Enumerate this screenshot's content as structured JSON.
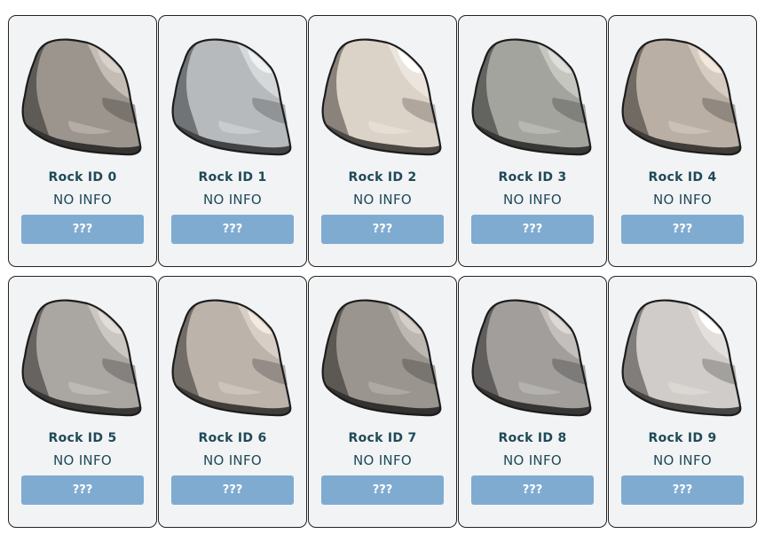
{
  "cards": [
    {
      "id_label": "Rock ID 0",
      "info": "NO INFO",
      "button": "???",
      "colors": {
        "main": "#9c958e",
        "light": "#c4bdb6",
        "highlight": "#d8d2cb",
        "dark": "#5e5a56",
        "darker": "#363432"
      }
    },
    {
      "id_label": "Rock ID 1",
      "info": "NO INFO",
      "button": "???",
      "colors": {
        "main": "#b7babd",
        "light": "#d5d8da",
        "highlight": "#f0f1f2",
        "dark": "#717477",
        "darker": "#414345"
      }
    },
    {
      "id_label": "Rock ID 2",
      "info": "NO INFO",
      "button": "???",
      "colors": {
        "main": "#dbd2c8",
        "light": "#ece5dd",
        "highlight": "#ffffff",
        "dark": "#8a837c",
        "darker": "#4c4844"
      }
    },
    {
      "id_label": "Rock ID 3",
      "info": "NO INFO",
      "button": "???",
      "colors": {
        "main": "#a4a49f",
        "light": "#c6c6c1",
        "highlight": "#dededa",
        "dark": "#63635f",
        "darker": "#383836"
      }
    },
    {
      "id_label": "Rock ID 4",
      "info": "NO INFO",
      "button": "???",
      "colors": {
        "main": "#b9afa5",
        "light": "#d6ccc2",
        "highlight": "#f2e8de",
        "dark": "#716a63",
        "darker": "#403c38"
      }
    },
    {
      "id_label": "Rock ID 5",
      "info": "NO INFO",
      "button": "???",
      "colors": {
        "main": "#aaa6a2",
        "light": "#cac6c2",
        "highlight": "#e2ddd7",
        "dark": "#666360",
        "darker": "#3a3836"
      }
    },
    {
      "id_label": "Rock ID 6",
      "info": "NO INFO",
      "button": "???",
      "colors": {
        "main": "#bcb3ab",
        "light": "#d7cec6",
        "highlight": "#f3eae2",
        "dark": "#726c67",
        "darker": "#413d3a"
      }
    },
    {
      "id_label": "Rock ID 7",
      "info": "NO INFO",
      "button": "???",
      "colors": {
        "main": "#9a958f",
        "light": "#bcb7b1",
        "highlight": "#d4cfc9",
        "dark": "#5c5955",
        "darker": "#343230"
      }
    },
    {
      "id_label": "Rock ID 8",
      "info": "NO INFO",
      "button": "???",
      "colors": {
        "main": "#a19e9b",
        "light": "#c2bfbc",
        "highlight": "#dcd9d6",
        "dark": "#615f5d",
        "darker": "#373635"
      }
    },
    {
      "id_label": "Rock ID 9",
      "info": "NO INFO",
      "button": "???",
      "colors": {
        "main": "#cfccc9",
        "light": "#e2dfdc",
        "highlight": "#ffffff",
        "dark": "#807d7a",
        "darker": "#484644"
      }
    }
  ]
}
